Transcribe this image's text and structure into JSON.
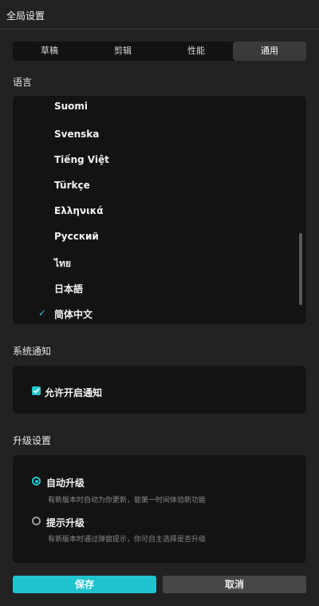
{
  "window": {
    "title": "全局设置"
  },
  "tabs": [
    {
      "label": "草稿",
      "active": false
    },
    {
      "label": "剪辑",
      "active": false
    },
    {
      "label": "性能",
      "active": false
    },
    {
      "label": "通用",
      "active": true
    }
  ],
  "language": {
    "section_label": "语言",
    "items": [
      "Suomi",
      "Svenska",
      "Tiếng Việt",
      "Türkçe",
      "Ελληνικά",
      "Русский",
      "ไทย",
      "日本語",
      "简体中文"
    ],
    "selected": "简体中文"
  },
  "notifications": {
    "section_label": "系统通知",
    "allow_label": "允许开启通知",
    "allow_checked": true
  },
  "upgrade": {
    "section_label": "升级设置",
    "options": [
      {
        "title": "自动升级",
        "desc": "有新版本时自动为你更新，能第一时间体验新功能",
        "selected": true
      },
      {
        "title": "提示升级",
        "desc": "有新版本时通过弹窗提示，你可自主选择是否升级",
        "selected": false
      }
    ]
  },
  "buttons": {
    "save": "保存",
    "cancel": "取消"
  },
  "colors": {
    "accent": "#22c5cf",
    "background": "#222222",
    "panel": "#131313"
  }
}
